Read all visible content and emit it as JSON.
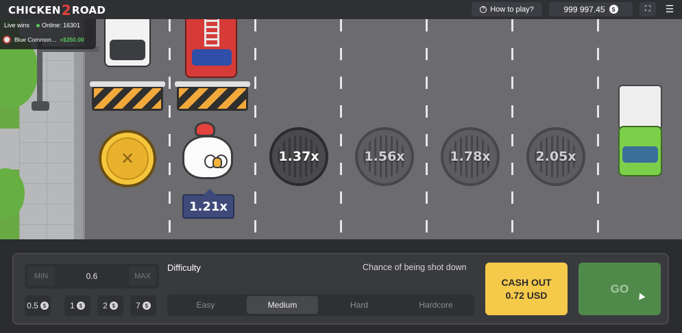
{
  "header": {
    "logo_part1": "CHICKEN",
    "logo_part2": "2",
    "logo_part3": "ROAD",
    "how_to_play": "How to play?",
    "balance": "999 997.45",
    "currency_symbol": "$"
  },
  "live": {
    "live_wins_label": "Live wins",
    "online_label": "Online: 16301",
    "recent_player": "Blue Common...",
    "recent_win": "+$350.00"
  },
  "game": {
    "current_multiplier": "1.21x",
    "lanes": [
      {
        "multiplier": "1.37x"
      },
      {
        "multiplier": "1.56x"
      },
      {
        "multiplier": "1.78x"
      },
      {
        "multiplier": "2.05x"
      }
    ]
  },
  "controls": {
    "min_label": "MIN",
    "max_label": "MAX",
    "bet_value": "0.6",
    "quick_bets": [
      "0.5",
      "1",
      "2",
      "7"
    ],
    "difficulty_label": "Difficulty",
    "chance_label": "Chance of being shot down",
    "difficulties": [
      "Easy",
      "Medium",
      "Hard",
      "Hardcore"
    ],
    "selected_difficulty": "Medium",
    "cashout_line1": "CASH OUT",
    "cashout_line2": "0.72 USD",
    "go_label": "GO"
  },
  "colors": {
    "cashout_bg": "#f5c94a",
    "go_bg": "#4f8a4a",
    "win_green": "#58c45c",
    "current_tag": "#3f4a7a"
  }
}
